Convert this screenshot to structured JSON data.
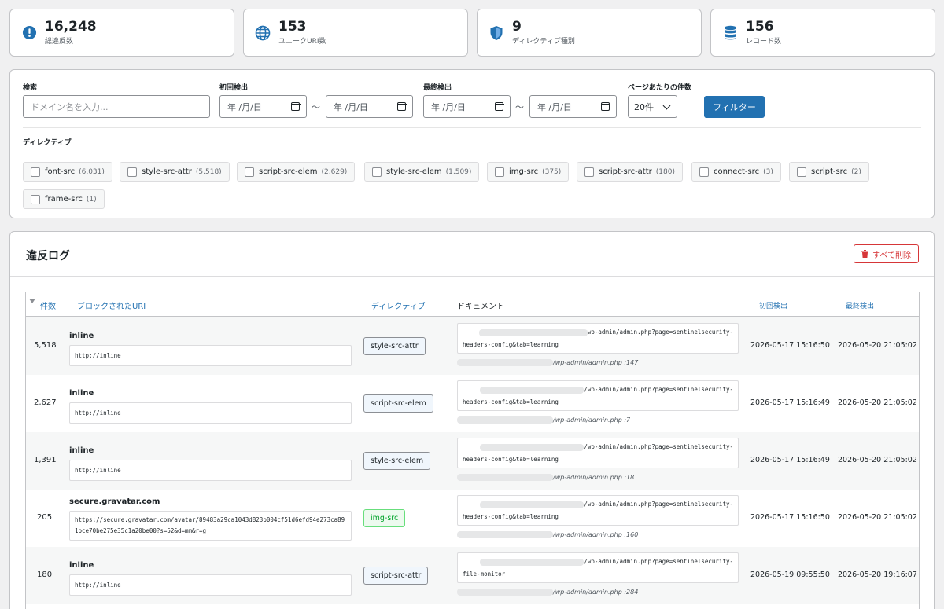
{
  "stats": [
    {
      "value": "16,248",
      "label": "総違反数",
      "icon": "exclamation-icon",
      "color": "#2271b1"
    },
    {
      "value": "153",
      "label": "ユニークURI数",
      "icon": "globe-icon",
      "color": "#2271b1"
    },
    {
      "value": "9",
      "label": "ディレクティブ種別",
      "icon": "shield-icon",
      "color": "#2271b1"
    },
    {
      "value": "156",
      "label": "レコード数",
      "icon": "database-icon",
      "color": "#2271b1"
    }
  ],
  "filters": {
    "search_label": "検索",
    "search_placeholder": "ドメイン名を入力...",
    "first_label": "初回検出",
    "last_label": "最終検出",
    "date_placeholder": "年 /月/日",
    "tilde": "〜",
    "per_page_label": "ページあたりの件数",
    "per_page_value": "20件",
    "filter_button": "フィルター",
    "directive_label": "ディレクティブ",
    "directives": [
      {
        "name": "font-src",
        "count": "(6,031)"
      },
      {
        "name": "style-src-attr",
        "count": "(5,518)"
      },
      {
        "name": "script-src-elem",
        "count": "(2,629)"
      },
      {
        "name": "style-src-elem",
        "count": "(1,509)"
      },
      {
        "name": "img-src",
        "count": "(375)"
      },
      {
        "name": "script-src-attr",
        "count": "(180)"
      },
      {
        "name": "connect-src",
        "count": "(3)"
      },
      {
        "name": "script-src",
        "count": "(2)"
      },
      {
        "name": "frame-src",
        "count": "(1)"
      }
    ]
  },
  "log": {
    "title": "違反ログ",
    "delete_all": "すべて削除",
    "columns": {
      "count": "件数",
      "blocked_uri": "ブロックされたURI",
      "directive": "ディレクティブ",
      "document": "ドキュメント",
      "first": "初回検出",
      "last": "最終検出"
    },
    "rows": [
      {
        "count": "5,518",
        "host": "inline",
        "uri": "http://inline",
        "directive": "style-src-attr",
        "badge": "blue",
        "doc_line1": "wp-admin/admin.php?page=sentinelsecurity-",
        "doc_line2": "headers-config&tab=learning",
        "source": "/wp-admin/admin.php :147",
        "first": "2026-05-17 15:16:50",
        "last": "2026-05-20 21:05:02"
      },
      {
        "count": "2,627",
        "host": "inline",
        "uri": "http://inline",
        "directive": "script-src-elem",
        "badge": "blue",
        "doc_line1": "/wp-admin/admin.php?page=sentinelsecurity-",
        "doc_line2": "headers-config&tab=learning",
        "source": "/wp-admin/admin.php :7",
        "first": "2026-05-17 15:16:49",
        "last": "2026-05-20 21:05:02"
      },
      {
        "count": "1,391",
        "host": "inline",
        "uri": "http://inline",
        "directive": "style-src-elem",
        "badge": "blue",
        "doc_line1": "/wp-admin/admin.php?page=sentinelsecurity-",
        "doc_line2": "headers-config&tab=learning",
        "source": "/wp-admin/admin.php :18",
        "first": "2026-05-17 15:16:49",
        "last": "2026-05-20 21:05:02"
      },
      {
        "count": "205",
        "host": "secure.gravatar.com",
        "uri": "https://secure.gravatar.com/avatar/89483a29ca1043d823b004cf51d6efd94e273ca891bce70be275e35c1a20be00?s=52&d=mm&r=g",
        "directive": "img-src",
        "badge": "green",
        "doc_line1": "/wp-admin/admin.php?page=sentinelsecurity-",
        "doc_line2": "headers-config&tab=learning",
        "source": "/wp-admin/admin.php :160",
        "first": "2026-05-17 15:16:50",
        "last": "2026-05-20 21:05:02"
      },
      {
        "count": "180",
        "host": "inline",
        "uri": "http://inline",
        "directive": "script-src-attr",
        "badge": "blue",
        "doc_line1": "/wp-admin/admin.php?page=sentinelsecurity-",
        "doc_line2": "file-monitor",
        "source": "/wp-admin/admin.php :284",
        "first": "2026-05-19 09:55:50",
        "last": "2026-05-20 19:16:07"
      }
    ]
  }
}
